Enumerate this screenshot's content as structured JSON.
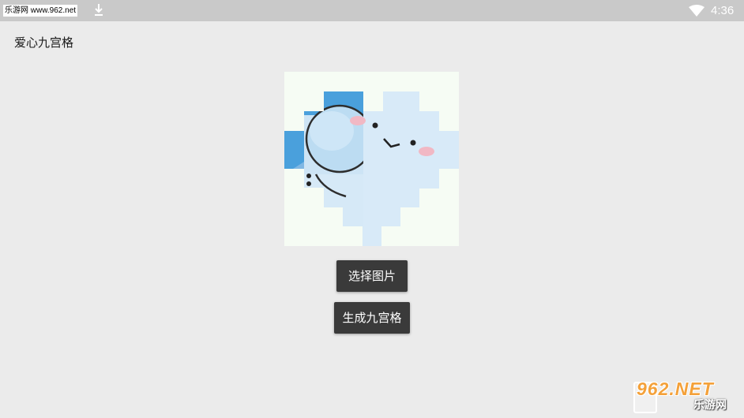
{
  "status_bar": {
    "watermark": "乐游网 www.962.net",
    "time": "4:36",
    "icons": [
      "notification-icons",
      "download-icon",
      "wifi-icon"
    ]
  },
  "app": {
    "title": "爱心九宫格"
  },
  "preview": {
    "icon": "heart-grid-image"
  },
  "buttons": {
    "select_image": "选择图片",
    "generate_grid": "生成九宫格"
  },
  "watermark": {
    "brand": "962.NET",
    "cn": "乐游网"
  },
  "colors": {
    "status_bar": "#c9c9c9",
    "background": "#ebebeb",
    "button": "#3a3a3a",
    "button_text": "#ffffff",
    "watermark_orange": "#f4a13a"
  }
}
